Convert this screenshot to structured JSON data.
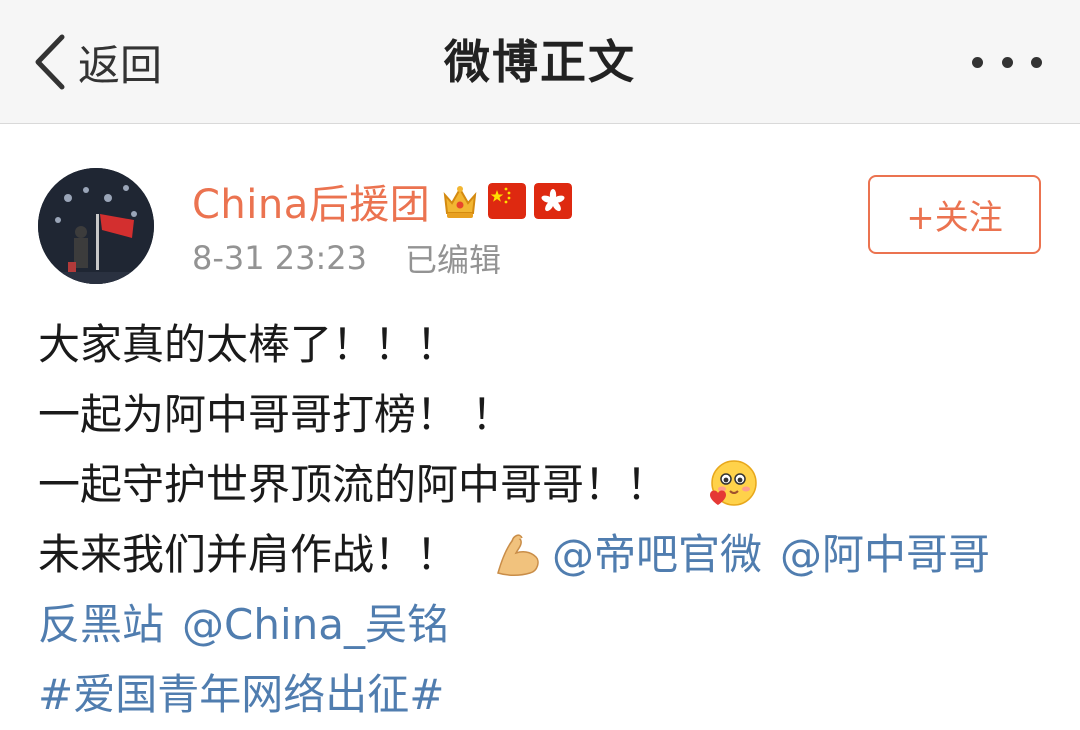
{
  "nav": {
    "back_label": "返回",
    "title": "微博正文"
  },
  "author": {
    "name": "China后援团",
    "time": "8-31 23:23",
    "edited": "已编辑",
    "follow_label": "+关注"
  },
  "post": {
    "line1": "大家真的太棒了！！！",
    "line2": "一起为阿中哥哥打榜！ ！",
    "line3": "一起守护世界顶流的阿中哥哥！！",
    "line4_text": "未来我们并肩作战！！",
    "mention1": "@帝吧官微",
    "mention2_part1": "@阿中哥哥",
    "mention2_part2": "反黑站",
    "mention3": "@China_吴铭",
    "hashtag": "#爱国青年网络出征#"
  },
  "icons": {
    "back": "chevron-left-icon",
    "more": "more-dots-icon",
    "crown": "crown-badge-icon",
    "flag_cn": "china-flag-icon",
    "flag_hk": "hong-kong-flag-icon",
    "emoji_love": "love-face-emoji",
    "emoji_muscle": "flexed-biceps-emoji"
  },
  "colors": {
    "accent": "#eb7350",
    "link": "#507daf",
    "meta": "#939393"
  }
}
